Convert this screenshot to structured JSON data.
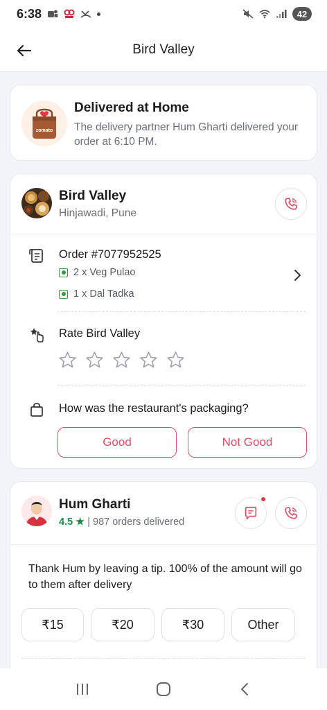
{
  "status_bar": {
    "time": "6:38",
    "battery": "42"
  },
  "header": {
    "title": "Bird Valley"
  },
  "delivery": {
    "title": "Delivered at Home",
    "subtitle": "The delivery partner Hum Gharti delivered your order at 6:10 PM.",
    "bag_label": "zomato"
  },
  "restaurant": {
    "name": "Bird Valley",
    "location": "Hinjawadi, Pune",
    "order_id": "Order #7077952525",
    "items": [
      "2 x Veg Pulao",
      "1 x Dal Tadka"
    ],
    "rate_title": "Rate Bird Valley",
    "star_count": 5,
    "packaging_question": "How was the restaurant's packaging?",
    "good_label": "Good",
    "not_good_label": "Not Good"
  },
  "rider": {
    "name": "Hum Gharti",
    "rating": "4.5 ★",
    "orders_delivered": "| 987 orders delivered",
    "tip_message": "Thank Hum by leaving a tip. 100% of the amount will go to them after delivery",
    "tips": [
      "₹15",
      "₹20",
      "₹30",
      "Other"
    ]
  },
  "colors": {
    "accent": "#d84e63",
    "veg_green": "#2a9d48",
    "rating_green": "#1e8a47"
  }
}
